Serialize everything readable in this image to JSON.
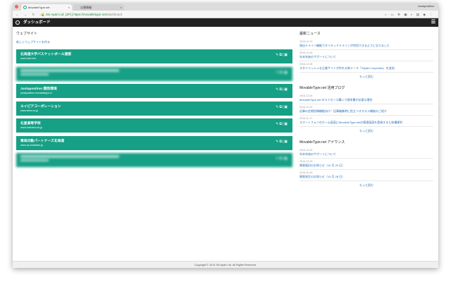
{
  "browser": {
    "tabs": [
      {
        "label": "MovableType.net"
      },
      {
        "label": "災害情報"
      }
    ],
    "user": "Juxtaposition",
    "address": {
      "secure_label": "Six Apart Ltd. [JP]",
      "url_host": "https://movabletype.net",
      "url_path": "/dashboard"
    }
  },
  "header": {
    "title": "ダッシュボード"
  },
  "websites": {
    "heading": "ウェブサイト",
    "new_link": "新しくウェブサイトを作る",
    "items": [
      {
        "name": "北海道大学バスケットボール連盟",
        "domain": "www.hcbf.info",
        "blurred": false
      },
      {
        "name": "",
        "domain": "",
        "blurred": true
      },
      {
        "name": "Juxtaposition 開発環境",
        "domain": "juxtaposition.movabletype.io",
        "blurred": false
      },
      {
        "name": "エイピアコーポレーション",
        "domain": "www.abea.co.jp",
        "blurred": false
      },
      {
        "name": "北星高等学校",
        "domain": "www.hokusho.ed.jp",
        "blurred": false
      },
      {
        "name": "東海日動パートナーズ北海道",
        "domain": "www.np-hokkaido.jp",
        "blurred": false
      },
      {
        "name": "",
        "domain": "",
        "blurred": true
      }
    ]
  },
  "news": [
    {
      "heading": "最新ニュース",
      "more": "もっと読む",
      "items": [
        {
          "date": "2016-12-12",
          "title": "独自ドメイン機能でネイキッドドメインが利用できるようになりました"
        },
        {
          "date": "2016-12-09",
          "title": "年末年始のサポートについて"
        },
        {
          "date": "2016-12-08",
          "title": "スタイリッシュな企業サイトが作れる新テーマ「Stylish Corporate」を追加"
        }
      ]
    },
    {
      "heading": "MovableType.net 活用ブログ",
      "more": "もっと読む",
      "items": [
        {
          "date": "2016-12-06",
          "title": "MovableType.net のライセンス購入で請求書が必要な場合"
        },
        {
          "date": "2016-11-24",
          "title": "記事の定期投稿機能向け！記事編集時に役立つオススメ機能のご紹介"
        },
        {
          "date": "2016-11-17",
          "title": "スマートフォンのホーム画面にMovableType.netの管理画面を登録すると結構便利"
        }
      ]
    },
    {
      "heading": "MovableType.net アナウンス",
      "more": "もっと読む",
      "items": [
        {
          "date": "2016-12-09",
          "title": "年末年始のサポートについて"
        },
        {
          "date": "2016-10-29",
          "title": "障害復旧のお知らせ（10 月 29 日）"
        },
        {
          "date": "2016-10-29",
          "title": "障害発生のお知らせ（10 月 28 日）"
        }
      ]
    }
  ],
  "footer": {
    "copyright": "Copyright © 2014 Six Apart Ltd. All Rights Reserved."
  }
}
